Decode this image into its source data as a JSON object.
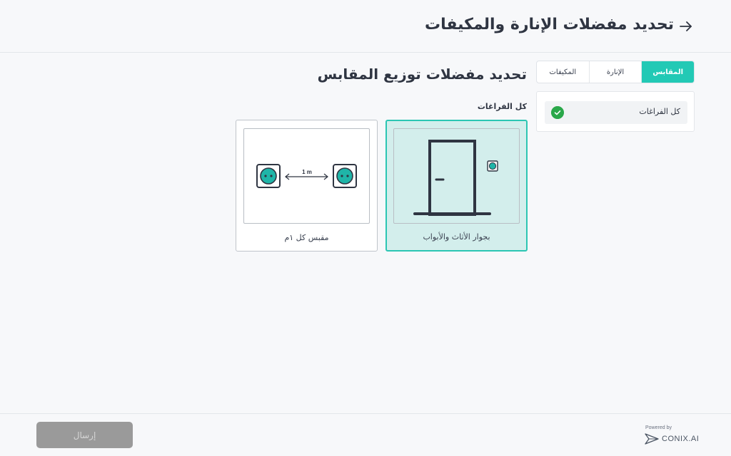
{
  "header": {
    "title": "تحديد مفضلات الإنارة والمكيفات",
    "back_icon": "arrow-right-icon"
  },
  "tabs": [
    {
      "label": "المكيفات",
      "active": false
    },
    {
      "label": "الإنارة",
      "active": false
    },
    {
      "label": "المقابس",
      "active": true
    }
  ],
  "spaces": {
    "items": [
      {
        "label": "كل الفراغات",
        "checked": true
      }
    ]
  },
  "section": {
    "title": "تحديد مفضلات توزيع المقابس",
    "group_label": "كل الفراغات",
    "options": [
      {
        "label": "مقبس كل ١م",
        "selected": false,
        "distance_label": "1 m",
        "icon": "socket-spacing-icon"
      },
      {
        "label": "بجوار الأثاث والأبواب",
        "selected": true,
        "icon": "door-socket-icon"
      }
    ]
  },
  "footer": {
    "submit_label": "إرسال",
    "powered_by": "Powered by",
    "brand": "CONIX.AI"
  },
  "colors": {
    "accent": "#22c9b5",
    "socket_fill": "#1fb5a8",
    "selected_bg": "#d3eeec",
    "check_green": "#2aa84a",
    "disabled_button": "#9a9a9a"
  }
}
